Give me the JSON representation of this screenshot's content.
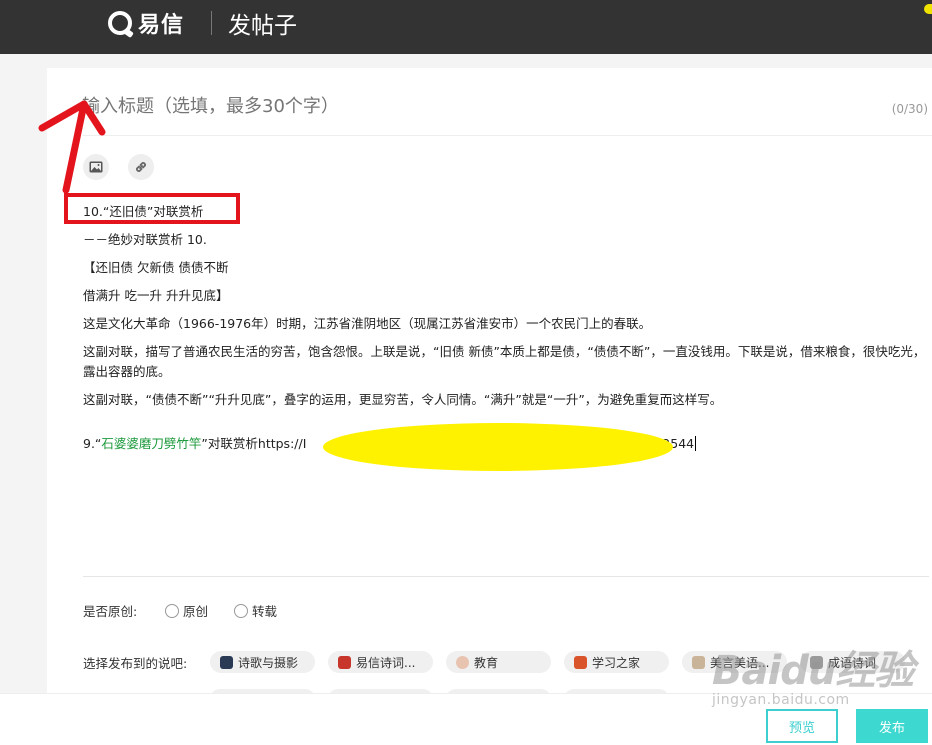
{
  "header": {
    "brand": "易信",
    "page_title": "发帖子"
  },
  "editor": {
    "title_placeholder": "输入标题（选填，最多30个字）",
    "title_count": "(0/30)",
    "image_icon": "image-icon",
    "link_icon": "link-icon",
    "content": {
      "heading": "10.“还旧债”对联赏析",
      "subtitle": "－－绝妙对联赏析 10.",
      "couplet_line1": "【还旧债 欠新债 债债不断",
      "couplet_line2": "借满升 吃一升 升升见底】",
      "para1": "这是文化大革命（1966-1976年）时期，江苏省淮阴地区（现属江苏省淮安市）一个农民门上的春联。",
      "para2": "这副对联，描写了普通农民生活的穷苦，饱含怨恨。上联是说，“旧债 新债”本质上都是债，“债债不断”，一直没钱用。下联是说，借来粮食，很快吃光，露出容器的底。",
      "para3": "这副对联，“债债不断”“升升见底”，叠字的运用，更显穷苦，令人同情。“满升”就是“一升”，为避免重复而这样写。",
      "link_prefix": "9.“",
      "link_title": "石婆婆磨刀劈竹竿",
      "link_suffix_text": "”对联赏析https://",
      "link_visible_start": "I",
      "link_visible_end": "312544"
    }
  },
  "options": {
    "original_label": "是否原创:",
    "original_option": "原创",
    "repost_option": "转载",
    "bar_label": "选择发布到的说吧:",
    "bars": [
      {
        "label": "诗歌与摄影",
        "icon_color": "#2a3a55"
      },
      {
        "label": "易信诗词...",
        "icon_color": "#c8362b"
      },
      {
        "label": "教育",
        "icon_color": "#e8c4b0"
      },
      {
        "label": "学习之家",
        "icon_color": "#d9542a"
      },
      {
        "label": "美言美语...",
        "icon_color": "#c9b49a"
      },
      {
        "label": "成语诗词",
        "icon_color": "#9a9a9a"
      }
    ]
  },
  "actions": {
    "preview": "预览",
    "publish": "发布"
  },
  "watermark": {
    "main": "Baidu经验",
    "sub": "jingyan.baidu.com"
  },
  "colors": {
    "header_bg": "#333333",
    "accent": "#3dd8d0",
    "annotation_red": "#e4141d",
    "redaction_yellow": "#fff200",
    "link_green": "#1d9a3d"
  }
}
